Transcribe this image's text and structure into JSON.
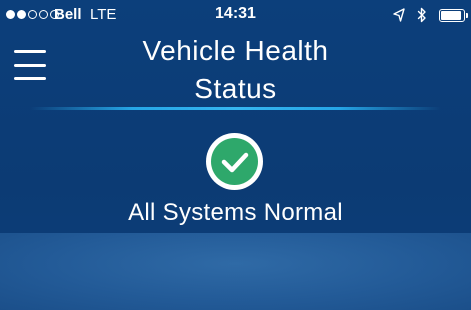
{
  "status_bar": {
    "signal_filled": 2,
    "signal_total": 5,
    "carrier": "Bell",
    "network": "LTE",
    "time": "14:31",
    "icons": [
      "location-arrow-icon",
      "bluetooth-icon",
      "battery-icon"
    ],
    "battery_level": 0.9
  },
  "header": {
    "menu_icon": "hamburger-menu-icon",
    "title_line1": "Vehicle Health",
    "title_line2": "Status"
  },
  "health": {
    "icon": "check-circle-icon",
    "status_text": "All Systems Normal"
  },
  "colors": {
    "background": "#0c3f7b",
    "divider": "#26a6e6",
    "check_green": "#2ea86b",
    "lower_panel": "#235b98"
  }
}
